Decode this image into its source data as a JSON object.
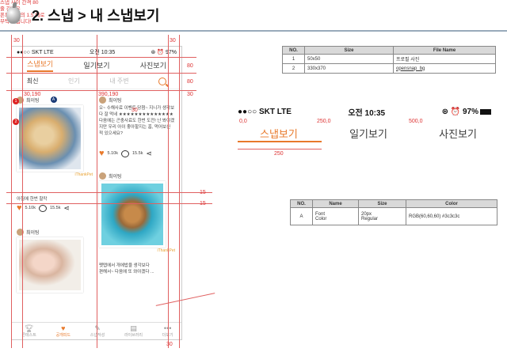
{
  "slide": {
    "title": "2. 스냅 > 내 스냅보기"
  },
  "phone": {
    "status": {
      "carrier": "●●○○ SKT  LTE",
      "time": "오전 10:35",
      "right": "⊛ ⏰ 97%"
    },
    "tabs": [
      "스냅보기",
      "일기보기",
      "사진보기"
    ],
    "subtabs": [
      "최신",
      "인기",
      "내 주변"
    ],
    "left_post": {
      "user": "최이팅",
      "brand": "iThankPet",
      "likes": "5.10k",
      "comments": "15.5k"
    },
    "right_post": {
      "user": "최이팅",
      "text": "오~ 수해사료 이벤트 당첨~ 지니가 생각보다 잘 먹네 ★★★★★★★★★★★★★★ 다음에는 곤충사료도 한번 도전! 난 봐야겠지만 우리 아이 좋아할지는 흠, 먹어보신 적 있으세요?",
      "brand": "iThankPet",
      "likes": "5.10k",
      "comments": "15.5k"
    },
    "left_caption": "아침에 한번 찰칵",
    "left_post2": {
      "user": "최이팅",
      "likes": "5.10k",
      "comments": "15.5k"
    },
    "right_post2": {
      "user": "최이팅",
      "brand": "iThankPet",
      "text": "펫탭에서 개에밥을 생각보다 편해서~ 다음에 또 와야겠다 ..."
    },
    "tabbar": [
      "콘테스트",
      "공개피드",
      "스냅작성",
      "라이브러리",
      "더보기"
    ]
  },
  "annotations": {
    "dims": {
      "top": "30",
      "bottom": "30",
      "right": "30",
      "side": "30",
      "h80a": "80",
      "h80b": "80",
      "h30": "30",
      "card_left": "30,190",
      "card_right": "390,190",
      "gap15a": "15",
      "gap15b": "15",
      "d0": "0,0",
      "d250a": "250,0",
      "d500": "500,0",
      "w250": "250"
    },
    "card_gap": "스냅 사이 간격 80",
    "line_gap_note": "줄 간격은\n폰트 크기의 1.5 배로\n부탁 드립니다!"
  },
  "spec_header": {
    "carrier": "●●○○ SKT  LTE",
    "time": "오전 10:35",
    "battery": "⊛ ⏰ 97%",
    "tabs": [
      "스냅보기",
      "일기보기",
      "사진보기"
    ]
  },
  "file_table": {
    "headers": [
      "NO.",
      "Size",
      "File Name"
    ],
    "rows": [
      [
        "1",
        "50x50",
        "프로필 사진"
      ],
      [
        "2",
        "330x370",
        "opensnap_bg"
      ]
    ]
  },
  "font_table": {
    "headers": [
      "NO.",
      "Name",
      "Size",
      "Color"
    ],
    "rows": [
      [
        "A",
        "Font\nColor",
        "20px\nRegular",
        "RGB(60,60,60)  #3c3c3c"
      ]
    ]
  },
  "colors": {
    "accent": "#e8792b",
    "guide": "#e06060",
    "text": "#3c3c3c"
  }
}
